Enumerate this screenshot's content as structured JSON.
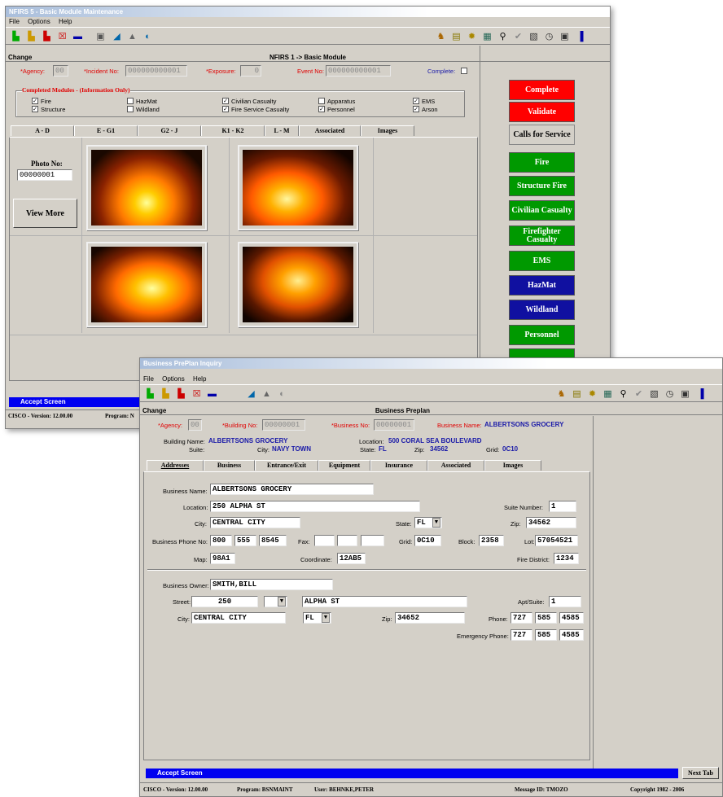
{
  "win1": {
    "title": "NFIRS 5 - Basic Module Maintenance",
    "menu": [
      "File",
      "Options",
      "Help"
    ],
    "mode": "Change",
    "header": "NFIRS 1 -> Basic Module",
    "agency_label": "*Agency:",
    "agency_value": "00",
    "incident_label": "*Incident No:",
    "incident_value": "000000000001",
    "exposure_label": "*Exposure:",
    "exposure_value": "0",
    "event_label": "Event No:",
    "event_value": "000000000001",
    "complete_label": "Complete:",
    "modules_title": "Completed Modules - (Information Only)",
    "modules": [
      {
        "label": "Fire",
        "checked": true
      },
      {
        "label": "Structure",
        "checked": true
      },
      {
        "label": "HazMat",
        "checked": false
      },
      {
        "label": "Wildland",
        "checked": false
      },
      {
        "label": "Civilian Casualty",
        "checked": true
      },
      {
        "label": "Fire Service Casualty",
        "checked": true
      },
      {
        "label": "Apparatus",
        "checked": false
      },
      {
        "label": "Personnel",
        "checked": true
      },
      {
        "label": "EMS",
        "checked": true
      },
      {
        "label": "Arson",
        "checked": true
      }
    ],
    "tabs": [
      "A - D",
      "E - G1",
      "G2 - J",
      "K1 - K2",
      "L - M",
      "Associated",
      "Images"
    ],
    "photo_no_label": "Photo No:",
    "photo_no_value": "00000001",
    "view_more": "View More",
    "side_buttons": [
      {
        "label": "Complete",
        "color": "#ff0000"
      },
      {
        "label": "Validate",
        "color": "#ff0000"
      },
      {
        "label": "Calls for Service",
        "color": "#d4d0c8"
      },
      {
        "label": "Fire",
        "color": "#009900"
      },
      {
        "label": "Structure Fire",
        "color": "#009900"
      },
      {
        "label": "Civilian Casualty",
        "color": "#009900"
      },
      {
        "label": "Firefighter Casualty",
        "color": "#009900"
      },
      {
        "label": "EMS",
        "color": "#009900"
      },
      {
        "label": "HazMat",
        "color": "#1010a0"
      },
      {
        "label": "Wildland",
        "color": "#1010a0"
      },
      {
        "label": "Personnel",
        "color": "#009900"
      }
    ],
    "status": "Accept Screen",
    "footer_version": "CISCO - Version: 12.00.00",
    "footer_program": "Program: N"
  },
  "win2": {
    "title": "Business PrePlan Inquiry",
    "menu": [
      "File",
      "Options",
      "Help"
    ],
    "mode": "Change",
    "header": "Business Preplan",
    "agency_label": "*Agency:",
    "agency_value": "00",
    "building_no_label": "*Building No:",
    "building_no_value": "00000001",
    "business_no_label": "*Business No:",
    "business_no_value": "00000001",
    "business_name_label": "Business Name:",
    "business_name_value": "ALBERTSONS GROCERY",
    "building_name_label": "Building Name:",
    "building_name_value": "ALBERTSONS GROCERY",
    "location_label": "Location:",
    "location_value": "500 CORAL SEA BOULEVARD",
    "suite_label": "Suite:",
    "city_label": "City:",
    "city_value": "NAVY TOWN",
    "state_label": "State:",
    "state_value": "FL",
    "zip_label": "Zip:",
    "zip_value": "34562",
    "grid_label": "Grid:",
    "grid_value": "0C10",
    "tabs": [
      "Addresses",
      "Business",
      "Entrance/Exit",
      "Equipment",
      "Insurance",
      "Associated",
      "Images"
    ],
    "form": {
      "business_name_label": "Business Name:",
      "business_name": "ALBERTSONS GROCERY",
      "location_label": "Location:",
      "location": "250 ALPHA ST",
      "suite_number_label": "Suite Number:",
      "suite_number": "1",
      "city_label": "City:",
      "city": "CENTRAL CITY",
      "state_label": "State:",
      "state": "FL",
      "zip_label": "Zip:",
      "zip": "34562",
      "phone_label": "Business Phone No:",
      "phone1": "800",
      "phone2": "555",
      "phone3": "8545",
      "fax_label": "Fax:",
      "grid_label": "Grid:",
      "grid": "0C10",
      "block_label": "Block:",
      "block": "2358",
      "lot_label": "Lot:",
      "lot": "57054521",
      "map_label": "Map:",
      "map": "98A1",
      "coordinate_label": "Coordinate:",
      "coordinate": "12AB5",
      "fire_district_label": "Fire District:",
      "fire_district": "1234",
      "owner_label": "Business Owner:",
      "owner": "SMITH,BILL",
      "street_label": "Street:",
      "street_no": "250",
      "street_name": "ALPHA ST",
      "apt_label": "Apt/Suite:",
      "apt": "1",
      "owner_city_label": "City:",
      "owner_city": "CENTRAL CITY",
      "owner_state": "FL",
      "owner_zip_label": "Zip:",
      "owner_zip": "34652",
      "owner_phone_label": "Phone:",
      "op1": "727",
      "op2": "585",
      "op3": "4585",
      "emerg_label": "Emergency Phone:",
      "ep1": "727",
      "ep2": "585",
      "ep3": "4585"
    },
    "status": "Accept Screen",
    "next_tab": "Next Tab",
    "footer": {
      "version": "CISCO - Version: 12.00.00",
      "program": "Program: BSNMAINT",
      "user": "User: BEHNKE,PETER",
      "message": "Message ID: TMOZO",
      "copyright": "Copyright 1982 - 2006"
    }
  }
}
